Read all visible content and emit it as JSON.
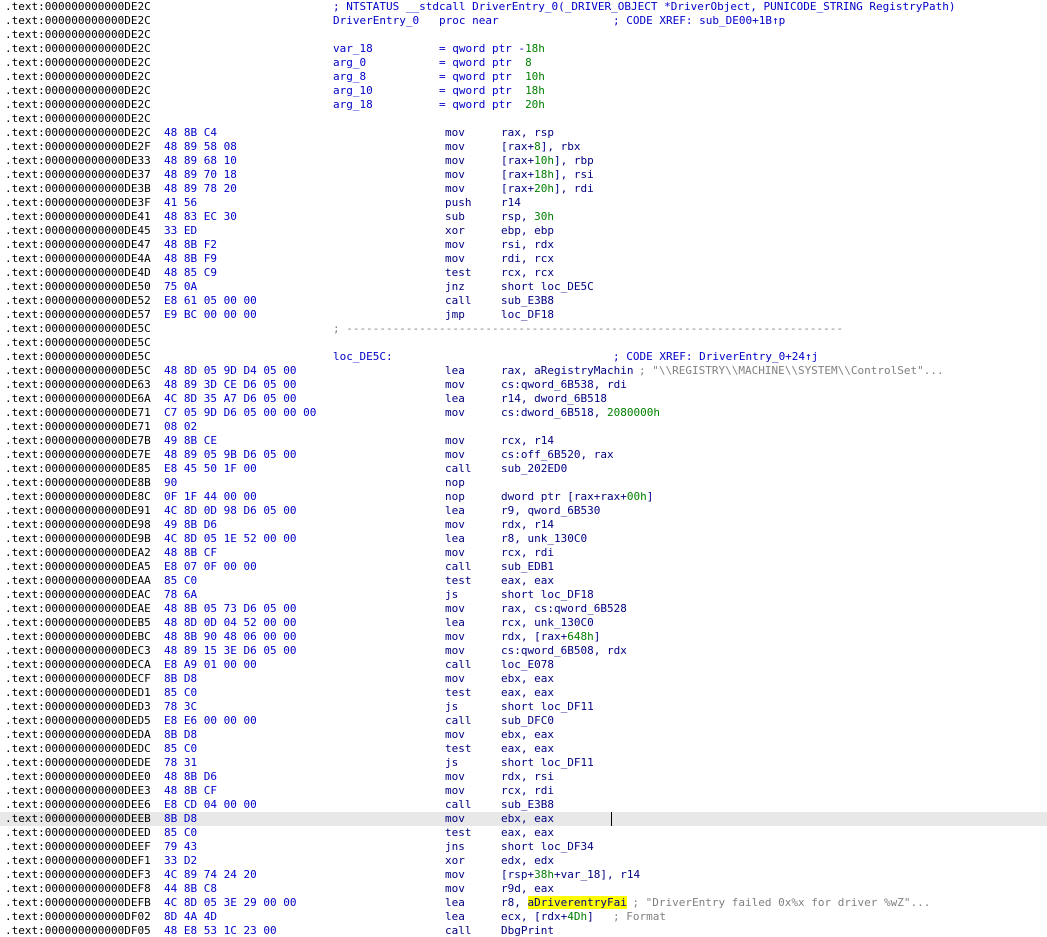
{
  "lines": [
    {
      "addr": ".text:000000000000DE2C",
      "label": "; NTSTATUS __stdcall DriverEntry_0(_DRIVER_OBJECT *DriverObject, PUNICODE_STRING RegistryPath)"
    },
    {
      "addr": ".text:000000000000DE2C",
      "label": "DriverEntry_0   proc near",
      "comment": "; CODE XREF: sub_DE00+1B↑p"
    },
    {
      "addr": ".text:000000000000DE2C"
    },
    {
      "addr": ".text:000000000000DE2C",
      "label": "var_18          = qword ptr -18h"
    },
    {
      "addr": ".text:000000000000DE2C",
      "label": "arg_0           = qword ptr  8"
    },
    {
      "addr": ".text:000000000000DE2C",
      "label": "arg_8           = qword ptr  10h"
    },
    {
      "addr": ".text:000000000000DE2C",
      "label": "arg_10          = qword ptr  18h"
    },
    {
      "addr": ".text:000000000000DE2C",
      "label": "arg_18          = qword ptr  20h"
    },
    {
      "addr": ".text:000000000000DE2C"
    },
    {
      "addr": ".text:000000000000DE2C",
      "bytes": "48 8B C4",
      "mnem": "mov",
      "ops": "rax, rsp"
    },
    {
      "addr": ".text:000000000000DE2F",
      "bytes": "48 89 58 08",
      "mnem": "mov",
      "ops": "[rax+8], rbx"
    },
    {
      "addr": ".text:000000000000DE33",
      "bytes": "48 89 68 10",
      "mnem": "mov",
      "ops": "[rax+10h], rbp"
    },
    {
      "addr": ".text:000000000000DE37",
      "bytes": "48 89 70 18",
      "mnem": "mov",
      "ops": "[rax+18h], rsi"
    },
    {
      "addr": ".text:000000000000DE3B",
      "bytes": "48 89 78 20",
      "mnem": "mov",
      "ops": "[rax+20h], rdi"
    },
    {
      "addr": ".text:000000000000DE3F",
      "bytes": "41 56",
      "mnem": "push",
      "ops": "r14"
    },
    {
      "addr": ".text:000000000000DE41",
      "bytes": "48 83 EC 30",
      "mnem": "sub",
      "ops": "rsp, 30h"
    },
    {
      "addr": ".text:000000000000DE45",
      "bytes": "33 ED",
      "mnem": "xor",
      "ops": "ebp, ebp"
    },
    {
      "addr": ".text:000000000000DE47",
      "bytes": "48 8B F2",
      "mnem": "mov",
      "ops": "rsi, rdx"
    },
    {
      "addr": ".text:000000000000DE4A",
      "bytes": "48 8B F9",
      "mnem": "mov",
      "ops": "rdi, rcx"
    },
    {
      "addr": ".text:000000000000DE4D",
      "bytes": "48 85 C9",
      "mnem": "test",
      "ops": "rcx, rcx"
    },
    {
      "addr": ".text:000000000000DE50",
      "bytes": "75 0A",
      "mnem": "jnz",
      "ops": "short loc_DE5C"
    },
    {
      "addr": ".text:000000000000DE52",
      "bytes": "E8 61 05 00 00",
      "mnem": "call",
      "ops": "sub_E3B8"
    },
    {
      "addr": ".text:000000000000DE57",
      "bytes": "E9 BC 00 00 00",
      "mnem": "jmp",
      "ops": "loc_DF18"
    },
    {
      "addr": ".text:000000000000DE5C",
      "separator": "; ---------------------------------------------------------------------------"
    },
    {
      "addr": ".text:000000000000DE5C"
    },
    {
      "addr": ".text:000000000000DE5C",
      "label": "loc_DE5C:",
      "comment": "; CODE XREF: DriverEntry_0+24↑j"
    },
    {
      "addr": ".text:000000000000DE5C",
      "bytes": "48 8D 05 9D D4 05 00",
      "mnem": "lea",
      "ops": "rax, aRegistryMachin",
      "comment": "; \"\\\\REGISTRY\\\\MACHINE\\\\SYSTEM\\\\ControlSet\"..."
    },
    {
      "addr": ".text:000000000000DE63",
      "bytes": "48 89 3D CE D6 05 00",
      "mnem": "mov",
      "ops": "cs:qword_6B538, rdi"
    },
    {
      "addr": ".text:000000000000DE6A",
      "bytes": "4C 8D 35 A7 D6 05 00",
      "mnem": "lea",
      "ops": "r14, dword_6B518"
    },
    {
      "addr": ".text:000000000000DE71",
      "bytes": "C7 05 9D D6 05 00 00 00",
      "mnem": "mov",
      "ops": "cs:dword_6B518, 2080000h"
    },
    {
      "addr": ".text:000000000000DE71",
      "bytes": "08 02"
    },
    {
      "addr": ".text:000000000000DE7B",
      "bytes": "49 8B CE",
      "mnem": "mov",
      "ops": "rcx, r14"
    },
    {
      "addr": ".text:000000000000DE7E",
      "bytes": "48 89 05 9B D6 05 00",
      "mnem": "mov",
      "ops": "cs:off_6B520, rax"
    },
    {
      "addr": ".text:000000000000DE85",
      "bytes": "E8 45 50 1F 00",
      "mnem": "call",
      "ops": "sub_202ED0"
    },
    {
      "addr": ".text:000000000000DE8B",
      "bytes": "90",
      "mnem": "nop"
    },
    {
      "addr": ".text:000000000000DE8C",
      "bytes": "0F 1F 44 00 00",
      "mnem": "nop",
      "ops": "dword ptr [rax+rax+00h]"
    },
    {
      "addr": ".text:000000000000DE91",
      "bytes": "4C 8D 0D 98 D6 05 00",
      "mnem": "lea",
      "ops": "r9, qword_6B530"
    },
    {
      "addr": ".text:000000000000DE98",
      "bytes": "49 8B D6",
      "mnem": "mov",
      "ops": "rdx, r14"
    },
    {
      "addr": ".text:000000000000DE9B",
      "bytes": "4C 8D 05 1E 52 00 00",
      "mnem": "lea",
      "ops": "r8, unk_130C0"
    },
    {
      "addr": ".text:000000000000DEA2",
      "bytes": "48 8B CF",
      "mnem": "mov",
      "ops": "rcx, rdi"
    },
    {
      "addr": ".text:000000000000DEA5",
      "bytes": "E8 07 0F 00 00",
      "mnem": "call",
      "ops": "sub_EDB1"
    },
    {
      "addr": ".text:000000000000DEAA",
      "bytes": "85 C0",
      "mnem": "test",
      "ops": "eax, eax"
    },
    {
      "addr": ".text:000000000000DEAC",
      "bytes": "78 6A",
      "mnem": "js",
      "ops": "short loc_DF18"
    },
    {
      "addr": ".text:000000000000DEAE",
      "bytes": "48 8B 05 73 D6 05 00",
      "mnem": "mov",
      "ops": "rax, cs:qword_6B528"
    },
    {
      "addr": ".text:000000000000DEB5",
      "bytes": "48 8D 0D 04 52 00 00",
      "mnem": "lea",
      "ops": "rcx, unk_130C0"
    },
    {
      "addr": ".text:000000000000DEBC",
      "bytes": "48 8B 90 48 06 00 00",
      "mnem": "mov",
      "ops": "rdx, [rax+648h]"
    },
    {
      "addr": ".text:000000000000DEC3",
      "bytes": "48 89 15 3E D6 05 00",
      "mnem": "mov",
      "ops": "cs:qword_6B508, rdx"
    },
    {
      "addr": ".text:000000000000DECA",
      "bytes": "E8 A9 01 00 00",
      "mnem": "call",
      "ops": "loc_E078"
    },
    {
      "addr": ".text:000000000000DECF",
      "bytes": "8B D8",
      "mnem": "mov",
      "ops": "ebx, eax"
    },
    {
      "addr": ".text:000000000000DED1",
      "bytes": "85 C0",
      "mnem": "test",
      "ops": "eax, eax"
    },
    {
      "addr": ".text:000000000000DED3",
      "bytes": "78 3C",
      "mnem": "js",
      "ops": "short loc_DF11"
    },
    {
      "addr": ".text:000000000000DED5",
      "bytes": "E8 E6 00 00 00",
      "mnem": "call",
      "ops": "sub_DFC0"
    },
    {
      "addr": ".text:000000000000DEDA",
      "bytes": "8B D8",
      "mnem": "mov",
      "ops": "ebx, eax"
    },
    {
      "addr": ".text:000000000000DEDC",
      "bytes": "85 C0",
      "mnem": "test",
      "ops": "eax, eax"
    },
    {
      "addr": ".text:000000000000DEDE",
      "bytes": "78 31",
      "mnem": "js",
      "ops": "short loc_DF11"
    },
    {
      "addr": ".text:000000000000DEE0",
      "bytes": "48 8B D6",
      "mnem": "mov",
      "ops": "rdx, rsi"
    },
    {
      "addr": ".text:000000000000DEE3",
      "bytes": "48 8B CF",
      "mnem": "mov",
      "ops": "rcx, rdi"
    },
    {
      "addr": ".text:000000000000DEE6",
      "bytes": "E8 CD 04 00 00",
      "mnem": "call",
      "ops": "sub_E3B8"
    },
    {
      "addr": ".text:000000000000DEEB",
      "bytes": "8B D8",
      "mnem": "mov",
      "ops": "ebx, eax",
      "selected": true
    },
    {
      "addr": ".text:000000000000DEED",
      "bytes": "85 C0",
      "mnem": "test",
      "ops": "eax, eax"
    },
    {
      "addr": ".text:000000000000DEEF",
      "bytes": "79 43",
      "mnem": "jns",
      "ops": "short loc_DF34"
    },
    {
      "addr": ".text:000000000000DEF1",
      "bytes": "33 D2",
      "mnem": "xor",
      "ops": "edx, edx"
    },
    {
      "addr": ".text:000000000000DEF3",
      "bytes": "4C 89 74 24 20",
      "mnem": "mov",
      "ops": "[rsp+38h+var_18], r14"
    },
    {
      "addr": ".text:000000000000DEF8",
      "bytes": "44 8B C8",
      "mnem": "mov",
      "ops": "r9d, eax"
    },
    {
      "addr": ".text:000000000000DEFB",
      "bytes": "4C 8D 05 3E 29 00 00",
      "mnem": "lea",
      "ops": "r8, aDriverentryFai",
      "comment": "; \"DriverEntry failed 0x%x for driver %wZ\"..."
    },
    {
      "addr": ".text:000000000000DF02",
      "bytes": "8D 4A 4D",
      "mnem": "lea",
      "ops": "ecx, [rdx+4Dh]",
      "comment": "; Format"
    },
    {
      "addr": ".text:000000000000DF05",
      "bytes": "48 E8 53 1C 23 00",
      "mnem": "call",
      "ops": "DbgPrint"
    }
  ],
  "highlight_word": "aDriverentryFai",
  "colors": {
    "address": "#000000",
    "bytes": "#0000c8",
    "instruction": "#000080",
    "comment": "#808080",
    "numeric": "#008000",
    "selected_row": "#e8e8e8",
    "word_highlight": "#ffff00"
  }
}
